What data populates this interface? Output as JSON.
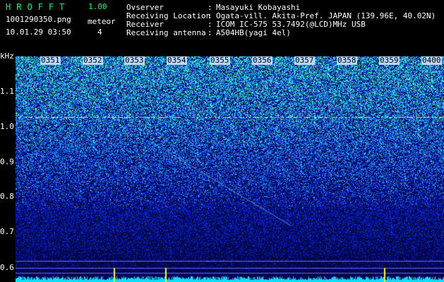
{
  "header": {
    "app_title": "HROFFT",
    "app_version": "1.00",
    "file_name": "1001290350.png",
    "datetime": "10.01.29 03:50",
    "meteor_label": "meteor",
    "meteor_count": "4"
  },
  "info": [
    {
      "key": "Ovserver",
      "value": "Masayuki Kobayashi"
    },
    {
      "key": "Receiving Location",
      "value": "Ogata-vill. Akita-Pref. JAPAN (139.96E, 40.02N)"
    },
    {
      "key": "Receiver",
      "value": "ICOM IC-575 53.7492(@LCD)MHz USB"
    },
    {
      "key": "Receiving antenna",
      "value": "A504HB(yagi 4el)"
    }
  ],
  "colon": ":",
  "spectrogram": {
    "y_unit": "kHz",
    "y_ticks": [
      "1.1",
      "1.0",
      "0.9",
      "0.8",
      "0.7",
      "0.6"
    ],
    "x_ticks": [
      "0351",
      "0352",
      "0353",
      "0354",
      "0355",
      "0356",
      "0357",
      "0358",
      "0359",
      "0400"
    ],
    "colors": {
      "background": "#000000",
      "low": "#001a66",
      "mid": "#2a5cff",
      "high": "#33ffcc",
      "trace": "#ffff33",
      "marker": "#ffff00"
    }
  }
}
